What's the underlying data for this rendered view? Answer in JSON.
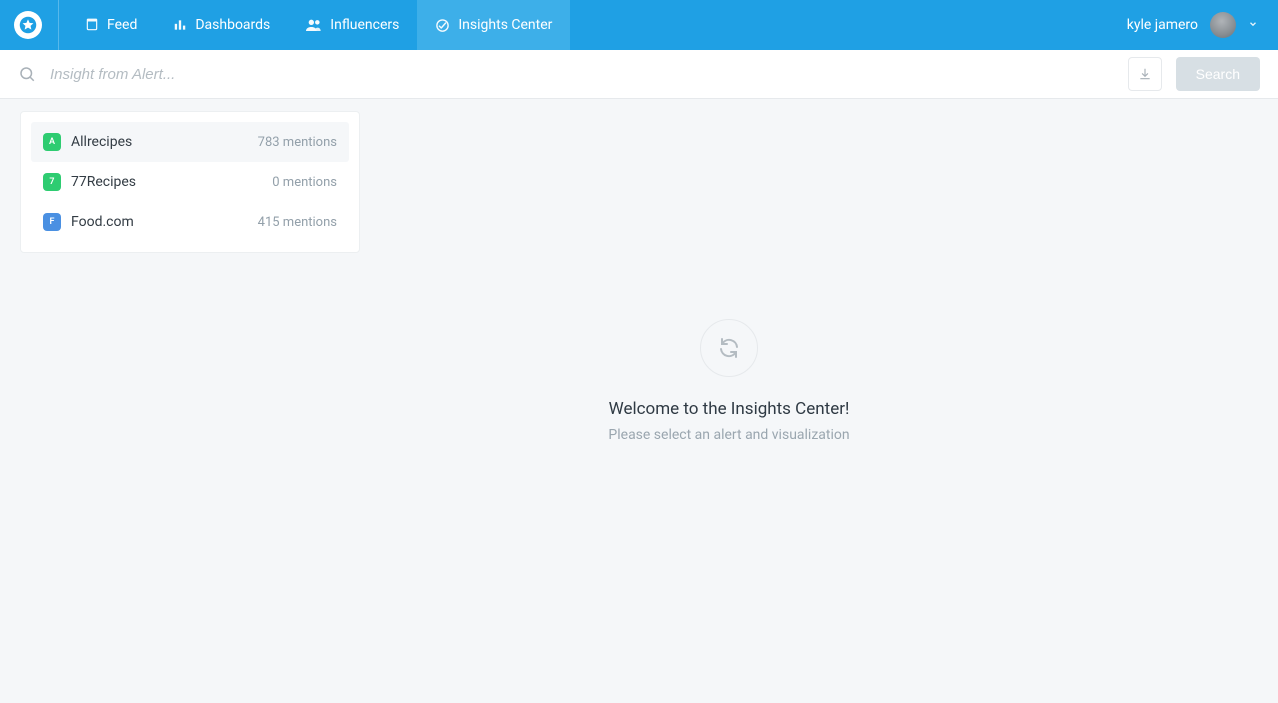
{
  "nav": {
    "items": [
      {
        "label": "Feed",
        "icon": "feed"
      },
      {
        "label": "Dashboards",
        "icon": "bars"
      },
      {
        "label": "Influencers",
        "icon": "people"
      },
      {
        "label": "Insights Center",
        "icon": "target"
      }
    ],
    "active_index": 3
  },
  "user": {
    "name": "kyle jamero"
  },
  "search": {
    "placeholder": "Insight from Alert...",
    "value": "",
    "button_label": "Search"
  },
  "alerts": [
    {
      "name": "Allrecipes",
      "mentions_text": "783 mentions",
      "badge_letter": "A",
      "badge_color": "green",
      "selected": true
    },
    {
      "name": "77Recipes",
      "mentions_text": "0 mentions",
      "badge_letter": "7",
      "badge_color": "green",
      "selected": false
    },
    {
      "name": "Food.com",
      "mentions_text": "415 mentions",
      "badge_letter": "F",
      "badge_color": "blue",
      "selected": false
    }
  ],
  "empty_state": {
    "title": "Welcome to the Insights Center!",
    "subtitle": "Please select an alert and visualization"
  },
  "colors": {
    "primary": "#1fa0e4",
    "primary_active": "#3dafe9",
    "badge_green": "#2ecc71",
    "badge_blue": "#4a90e2",
    "muted_text": "#93a0aa",
    "page_bg": "#f5f7f9"
  }
}
